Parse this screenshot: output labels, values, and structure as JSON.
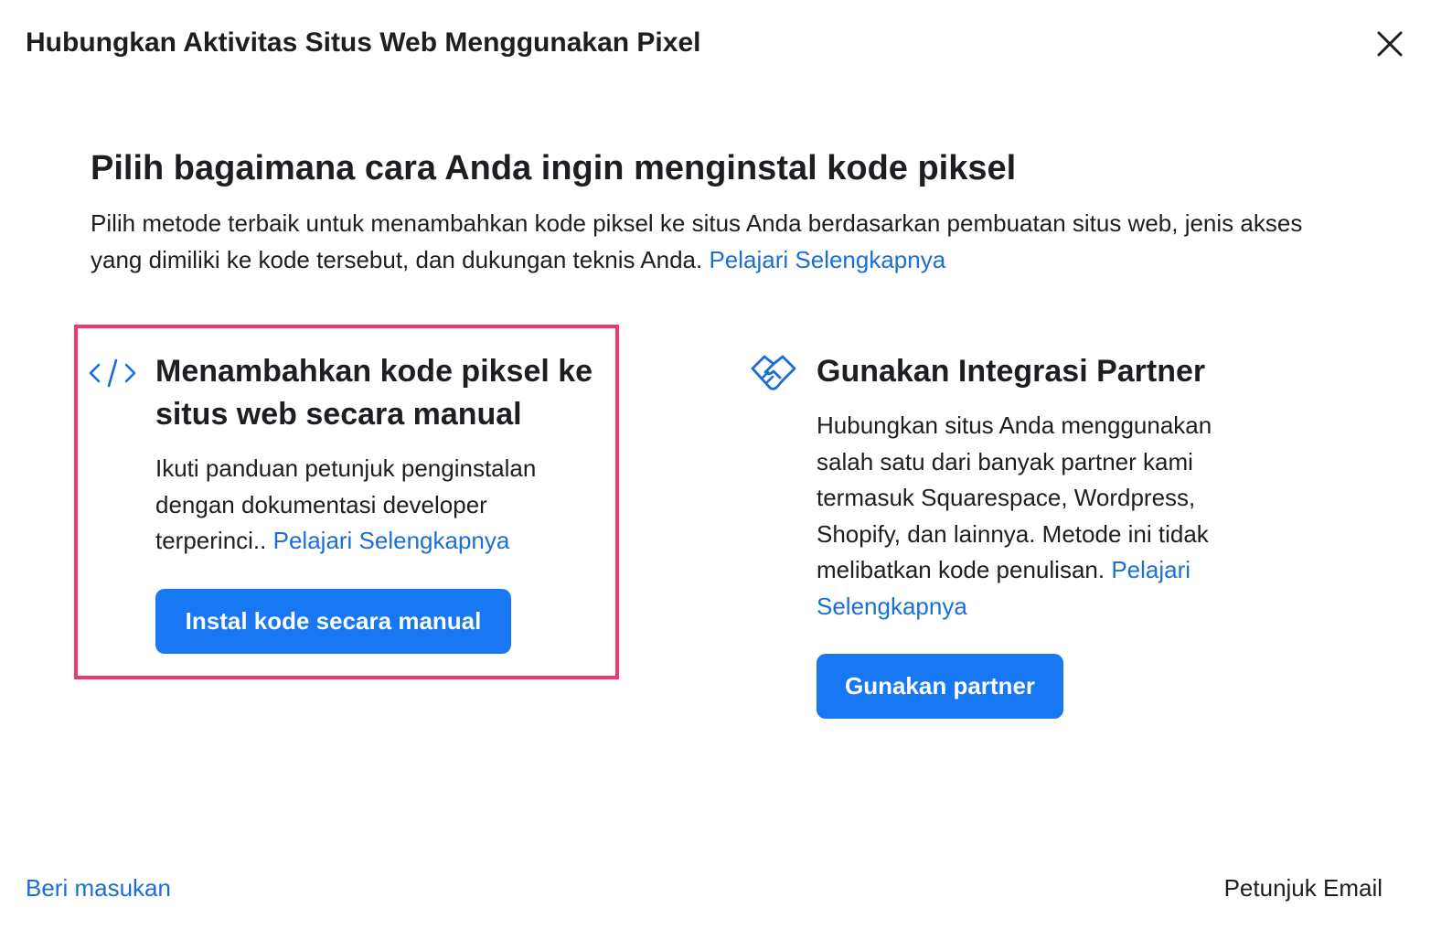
{
  "dialog": {
    "title": "Hubungkan Aktivitas Situs Web Menggunakan Pixel",
    "close_icon": "close-icon"
  },
  "main": {
    "heading": "Pilih bagaimana cara Anda ingin menginstal kode piksel",
    "description": "Pilih metode terbaik untuk menambahkan kode piksel ke situs Anda berdasarkan pembuatan situs web, jenis akses yang dimiliki ke kode tersebut, dan dukungan teknis Anda.",
    "learn_more": "Pelajari Selengkapnya"
  },
  "options": {
    "manual": {
      "icon": "code-icon",
      "title": "Menambahkan kode piksel ke situs web secara manual",
      "description": "Ikuti panduan petunjuk penginstalan dengan dokumentasi developer terperinci..",
      "learn_more": "Pelajari Selengkapnya",
      "button_label": "Instal kode secara manual"
    },
    "partner": {
      "icon": "handshake-icon",
      "title": "Gunakan Integrasi Partner",
      "description": "Hubungkan situs Anda menggunakan salah satu dari banyak partner kami termasuk Squarespace, Wordpress, Shopify, dan lainnya. Metode ini tidak melibatkan kode penulisan.",
      "learn_more": "Pelajari Selengkapnya",
      "button_label": "Gunakan partner"
    }
  },
  "footer": {
    "feedback": "Beri masukan",
    "email_instructions": "Petunjuk Email"
  },
  "colors": {
    "accent": "#1877f2",
    "link": "#1a6ed8",
    "highlight_border": "#f0386b",
    "text": "#1c1e21"
  }
}
